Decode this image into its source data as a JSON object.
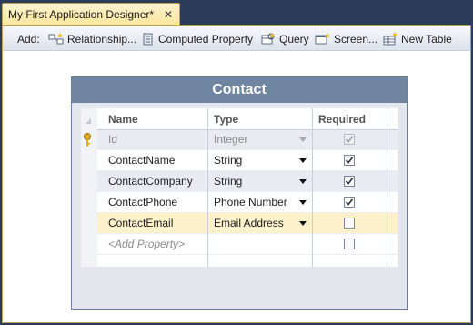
{
  "tab": {
    "title": "My First Application Designer*",
    "close_glyph": "✕"
  },
  "toolbar": {
    "add_label": "Add:",
    "items": [
      {
        "label": "Relationship...",
        "icon": "relationship-icon"
      },
      {
        "label": "Computed Property",
        "icon": "computed-property-icon"
      },
      {
        "label": "Query",
        "icon": "query-icon"
      },
      {
        "label": "Screen...",
        "icon": "screen-icon"
      },
      {
        "label": "New Table",
        "icon": "table-icon"
      }
    ]
  },
  "entity": {
    "name": "Contact",
    "columns": {
      "name": "Name",
      "type": "Type",
      "required": "Required"
    },
    "properties": [
      {
        "name": "Id",
        "type": "Integer",
        "required": true,
        "is_key": true,
        "disabled": true
      },
      {
        "name": "ContactName",
        "type": "String",
        "required": true
      },
      {
        "name": "ContactCompany",
        "type": "String",
        "required": true
      },
      {
        "name": "ContactPhone",
        "type": "Phone Number",
        "required": true
      },
      {
        "name": "ContactEmail",
        "type": "Email Address",
        "required": false,
        "selected": true
      }
    ],
    "add_property_placeholder": "<Add Property>"
  },
  "colors": {
    "background": "#2b3c59",
    "tab": "#f9e59b",
    "card_header": "#70859f",
    "selected_row": "#fdf1cc"
  }
}
